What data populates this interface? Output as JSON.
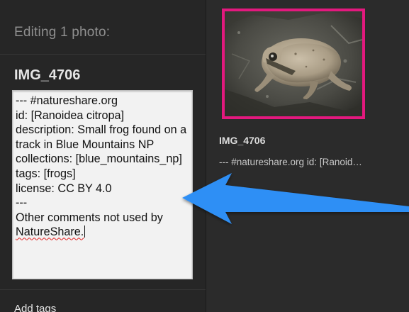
{
  "editor": {
    "header": "Editing 1 photo:",
    "photo_title": "IMG_4706",
    "description_lines": [
      "--- #natureshare.org",
      "id: [Ranoidea citropa]",
      "description: Small frog found on a",
      "track in Blue Mountains NP",
      "collections: [blue_mountains_np]",
      "tags: [frogs]",
      "license: CC BY 4.0",
      "---",
      "Other comments not used by",
      "NatureShare."
    ],
    "add_tags_label": "Add tags"
  },
  "grid": {
    "thumbnail_alt": "frog photo",
    "title": "IMG_4706",
    "description_preview": "--- #natureshare.org id: [Ranoid…"
  },
  "colors": {
    "selection_border": "#e3197e",
    "annotation_arrow": "#2f8ff5"
  },
  "icons": {
    "annotation": "left-arrow-icon"
  }
}
